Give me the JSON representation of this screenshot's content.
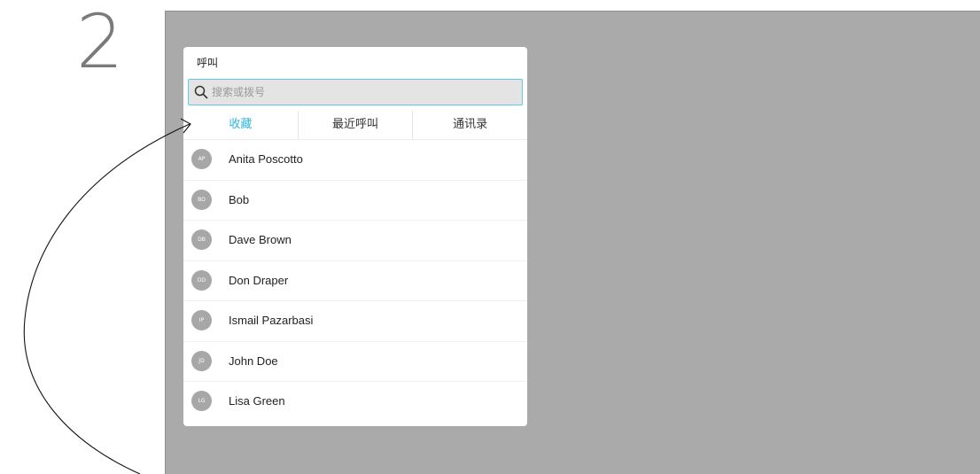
{
  "step_label": "2",
  "panel": {
    "title": "呼叫",
    "search": {
      "placeholder": "搜索或拨号",
      "value": "",
      "icon": "search-icon"
    },
    "tabs": [
      {
        "label": "收藏",
        "active": true
      },
      {
        "label": "最近呼叫",
        "active": false
      },
      {
        "label": "通讯录",
        "active": false
      }
    ],
    "contacts": [
      {
        "initials": "AP",
        "name": "Anita Poscotto"
      },
      {
        "initials": "BO",
        "name": "Bob"
      },
      {
        "initials": "DB",
        "name": "Dave Brown"
      },
      {
        "initials": "DD",
        "name": "Don Draper"
      },
      {
        "initials": "IP",
        "name": "Ismail Pazarbasi"
      },
      {
        "initials": "JD",
        "name": "John Doe"
      },
      {
        "initials": "LG",
        "name": "Lisa Green"
      }
    ]
  },
  "colors": {
    "accent": "#2fb5dc",
    "screen_background": "#aaaaaa",
    "avatar": "#a7a7a7"
  }
}
